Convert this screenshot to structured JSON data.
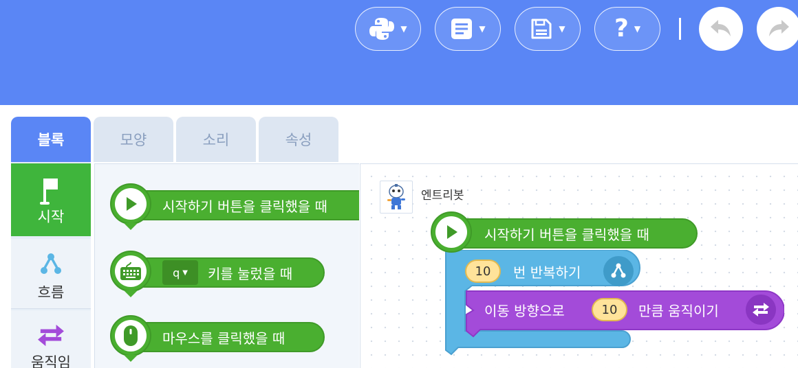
{
  "toolbar": {
    "python_icon": "python-icon",
    "document_icon": "document-icon",
    "save_icon": "save-icon",
    "help_label": "?",
    "undo_icon": "undo-icon",
    "redo_icon": "redo-icon"
  },
  "tabs": [
    {
      "label": "블록",
      "active": true
    },
    {
      "label": "모양",
      "active": false
    },
    {
      "label": "소리",
      "active": false
    },
    {
      "label": "속성",
      "active": false
    }
  ],
  "categories": [
    {
      "label": "시작",
      "icon": "flag-icon",
      "active": true
    },
    {
      "label": "흐름",
      "icon": "flow-icon",
      "active": false
    },
    {
      "label": "움직임",
      "icon": "move-arrows-icon",
      "active": false
    }
  ],
  "palette": {
    "start_click_label": "시작하기 버튼을 클릭했을 때",
    "key_value": "q",
    "key_pressed_label": "키를 눌렀을 때",
    "mouse_click_label": "마우스를 클릭했을 때"
  },
  "workspace": {
    "sprite_name": "엔트리봇",
    "hat_label": "시작하기 버튼을 클릭했을 때",
    "repeat_count": "10",
    "repeat_label": "번 반복하기",
    "move_prefix": "이동 방향으로",
    "move_count": "10",
    "move_suffix": "만큼 움직이기"
  },
  "colors": {
    "topbar": "#5a86f5",
    "start_green": "#4aaf30",
    "flow_blue": "#5bb6e5",
    "move_purple": "#a34bd9",
    "number_yellow": "#ffe39a"
  }
}
